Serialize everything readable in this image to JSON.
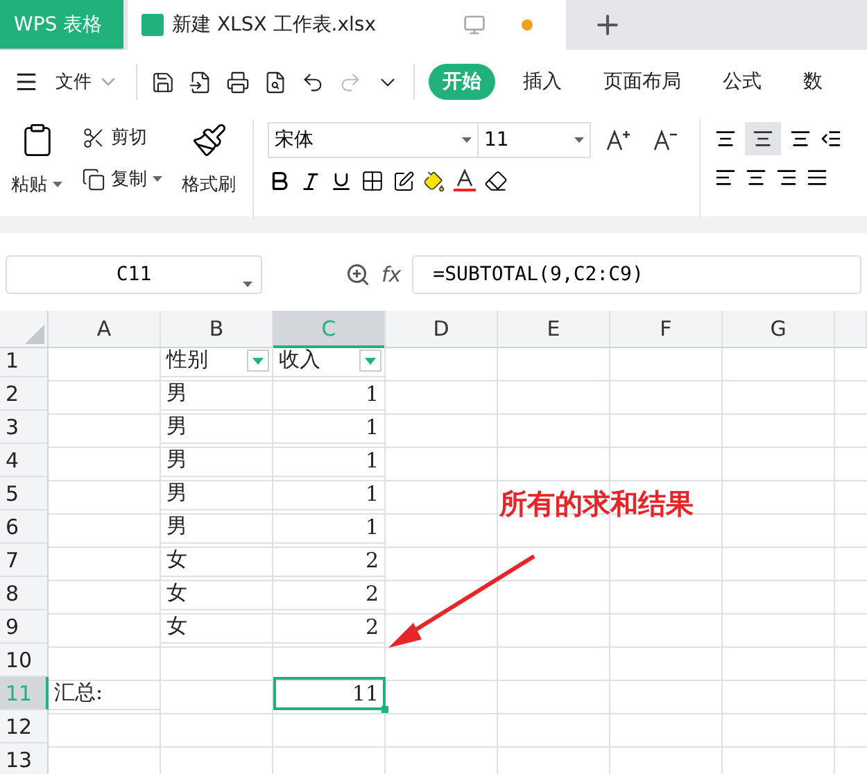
{
  "app_tabs": [
    {
      "label": "WPS 表格",
      "kind": "home",
      "selected": false
    },
    {
      "label": "新建 XLSX 工作表.xlsx",
      "kind": "doc",
      "selected": true,
      "unsaved": true
    }
  ],
  "file_menu": "文件",
  "ribbon_tabs": [
    {
      "label": "开始",
      "selected": true
    },
    {
      "label": "插入",
      "selected": false
    },
    {
      "label": "页面布局",
      "selected": false
    },
    {
      "label": "公式",
      "selected": false
    },
    {
      "label": "数",
      "selected": false
    }
  ],
  "clipboard": {
    "paste": "粘贴",
    "cut": "剪切",
    "copy": "复制",
    "format_painter": "格式刷"
  },
  "font": {
    "name": "宋体",
    "size": "11"
  },
  "name_box": "C11",
  "fx_label": "fx",
  "formula": "=SUBTOTAL(9,C2:C9)",
  "columns": [
    {
      "label": "A",
      "selected": false
    },
    {
      "label": "B",
      "selected": false
    },
    {
      "label": "C",
      "selected": true
    },
    {
      "label": "D",
      "selected": false
    },
    {
      "label": "E",
      "selected": false
    },
    {
      "label": "F",
      "selected": false
    },
    {
      "label": "G",
      "selected": false
    }
  ],
  "rows": [
    {
      "number": "1",
      "selected": false,
      "cells": [
        {},
        {
          "text": "性别",
          "filter": true
        },
        {
          "text": "收入",
          "filter": true
        }
      ]
    },
    {
      "number": "2",
      "selected": false,
      "cells": [
        {},
        {
          "text": "男"
        },
        {
          "text": "1",
          "kind": "number"
        }
      ]
    },
    {
      "number": "3",
      "selected": false,
      "cells": [
        {},
        {
          "text": "男"
        },
        {
          "text": "1",
          "kind": "number"
        }
      ]
    },
    {
      "number": "4",
      "selected": false,
      "cells": [
        {},
        {
          "text": "男"
        },
        {
          "text": "1",
          "kind": "number"
        }
      ]
    },
    {
      "number": "5",
      "selected": false,
      "cells": [
        {},
        {
          "text": "男"
        },
        {
          "text": "1",
          "kind": "number"
        }
      ]
    },
    {
      "number": "6",
      "selected": false,
      "cells": [
        {},
        {
          "text": "男"
        },
        {
          "text": "1",
          "kind": "number"
        }
      ]
    },
    {
      "number": "7",
      "selected": false,
      "cells": [
        {},
        {
          "text": "女"
        },
        {
          "text": "2",
          "kind": "number"
        }
      ]
    },
    {
      "number": "8",
      "selected": false,
      "cells": [
        {},
        {
          "text": "女"
        },
        {
          "text": "2",
          "kind": "number"
        }
      ]
    },
    {
      "number": "9",
      "selected": false,
      "cells": [
        {},
        {
          "text": "女"
        },
        {
          "text": "2",
          "kind": "number"
        }
      ]
    },
    {
      "number": "10",
      "selected": false,
      "cells": []
    },
    {
      "number": "11",
      "selected": true,
      "cells": [
        {
          "text": "汇总:"
        },
        {},
        {
          "text": "11",
          "kind": "number"
        }
      ]
    },
    {
      "number": "12",
      "selected": false,
      "cells": []
    },
    {
      "number": "13",
      "selected": false,
      "cells": []
    }
  ],
  "annotation": {
    "text": "所有的求和结果"
  }
}
